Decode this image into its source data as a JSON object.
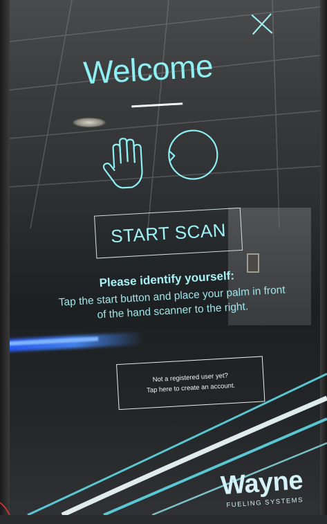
{
  "screen": {
    "title": "Welcome",
    "close_icon": "close-icon",
    "palm_icon": "palm-icon",
    "scanner_icon": "scanner-icon",
    "start_button_label": "START SCAN",
    "identify_heading": "Please identify yourself:",
    "identify_body_line1": "Tap the start button and place your palm in front",
    "identify_body_line2": "of the hand scanner to the right.",
    "register_line1": "Not a registered user yet?",
    "register_line2": "Tap here to create an account."
  },
  "brand": {
    "name": "Wayne",
    "subtitle": "FUELING SYSTEMS"
  },
  "colors": {
    "accent_cyan": "#8ff0f4",
    "line_white": "#f2f6f7",
    "scanner_led_blue": "#3f7dff",
    "swoosh_cyan": "#5fd8e6"
  }
}
